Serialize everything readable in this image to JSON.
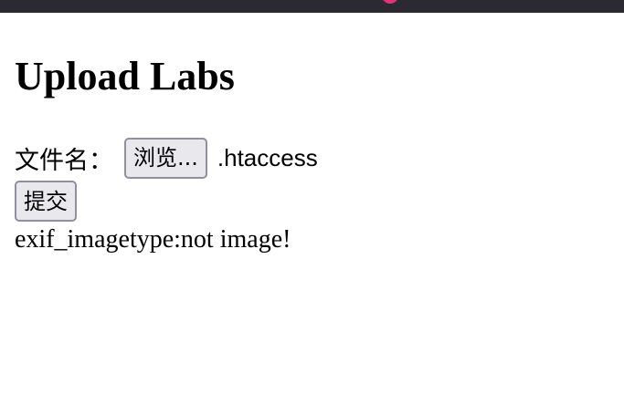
{
  "page": {
    "title": "Upload Labs"
  },
  "form": {
    "file_label": "文件名：",
    "browse_label": "浏览...",
    "selected_file": ".htaccess",
    "submit_label": "提交"
  },
  "result": {
    "message": "exif_imagetype:not image!"
  },
  "colors": {
    "top_bar": "#2b2a33",
    "top_bar_accent": "#e5307a",
    "button_bg": "#e9e9ed",
    "button_border": "#8f8f9d"
  }
}
